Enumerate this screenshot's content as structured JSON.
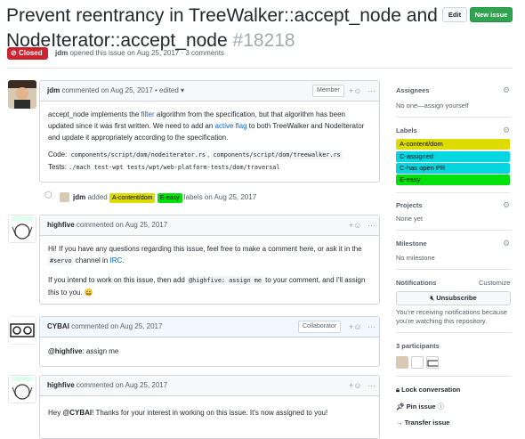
{
  "issue": {
    "title_line1": "Prevent reentrancy in TreeWalker::accept_node and",
    "title_line2": "NodeIterator::accept_node",
    "number": "#18218",
    "state": "Closed",
    "author": "jdm",
    "opened_text": "opened this issue on Aug 25, 2017 · 3 comments"
  },
  "header_buttons": {
    "edit": "Edit",
    "new_issue": "New issue"
  },
  "comments": [
    {
      "author": "jdm",
      "action": "commented on Aug 25, 2017",
      "edited": "• edited ▾",
      "role": "Member",
      "p1_a": "accept_node implements the ",
      "p1_link": "filter",
      "p1_b": " algorithm from the specification, but that algorithm has been updated since it was first written. We need to add an ",
      "p1_link2": "active flag",
      "p1_c": " to both TreeWalker and NodeIterator and update it appropriately according to the specification.",
      "code_label": "Code:",
      "code1": "components/script/dom/nodeiterator.rs",
      "code_sep": ", ",
      "code2": "components/script/dom/treewalker.rs",
      "tests_label": "Tests:",
      "tests": "./mach test-wpt tests/wpt/web-platform-tests/dom/traversal"
    },
    {
      "author": "highfive",
      "action": "commented on Aug 25, 2017",
      "p1_a": "Hi! If you have any questions regarding this issue, feel free to make a comment here, or ask it in the ",
      "p1_code": "#servo",
      "p1_b": " channel in ",
      "p1_link": "IRC",
      "p1_c": ".",
      "p2_a": "If you intend to work on this issue, then add ",
      "p2_code": "@highfive: assign me",
      "p2_b": " to your comment, and I'll assign this to you. ",
      "emoji": "😄"
    },
    {
      "author": "CYBAI",
      "action": "commented on Aug 25, 2017",
      "role": "Collaborator",
      "mention": "@highfive",
      "text": ": assign me"
    },
    {
      "author": "highfive",
      "action": "commented on Aug 25, 2017",
      "greet": "Hey ",
      "mention": "@CYBAI",
      "text": "! Thanks for your interest in working on this issue. It's now assigned to you!"
    }
  ],
  "label_event": {
    "actor": "jdm",
    "verb": "added",
    "label1": "A-content/dom",
    "label2": "E-easy",
    "suffix": "labels on Aug 25, 2017"
  },
  "sidebar": {
    "assignees_title": "Assignees",
    "assignees_text": "No one—assign yourself",
    "labels_title": "Labels",
    "labels": [
      {
        "name": "A-content/dom",
        "color": "#dcdc00"
      },
      {
        "name": "C-assigned",
        "color": "#02d7e1"
      },
      {
        "name": "C-has open PR",
        "color": "#02d7e1"
      },
      {
        "name": "E-easy",
        "color": "#02e10c"
      }
    ],
    "projects_title": "Projects",
    "projects_text": "None yet",
    "milestone_title": "Milestone",
    "milestone_text": "No milestone",
    "notifications_title": "Notifications",
    "customize": "Customize",
    "unsubscribe": "Unsubscribe",
    "notif_text": "You're receiving notifications because you're watching this repository.",
    "participants_title": "3 participants",
    "lock": "Lock conversation",
    "pin": "Pin issue",
    "transfer": "Transfer issue"
  },
  "colors": {
    "closed_red": "#cb2431",
    "link_blue": "#0366d6",
    "green_button": "#2ea44f"
  }
}
